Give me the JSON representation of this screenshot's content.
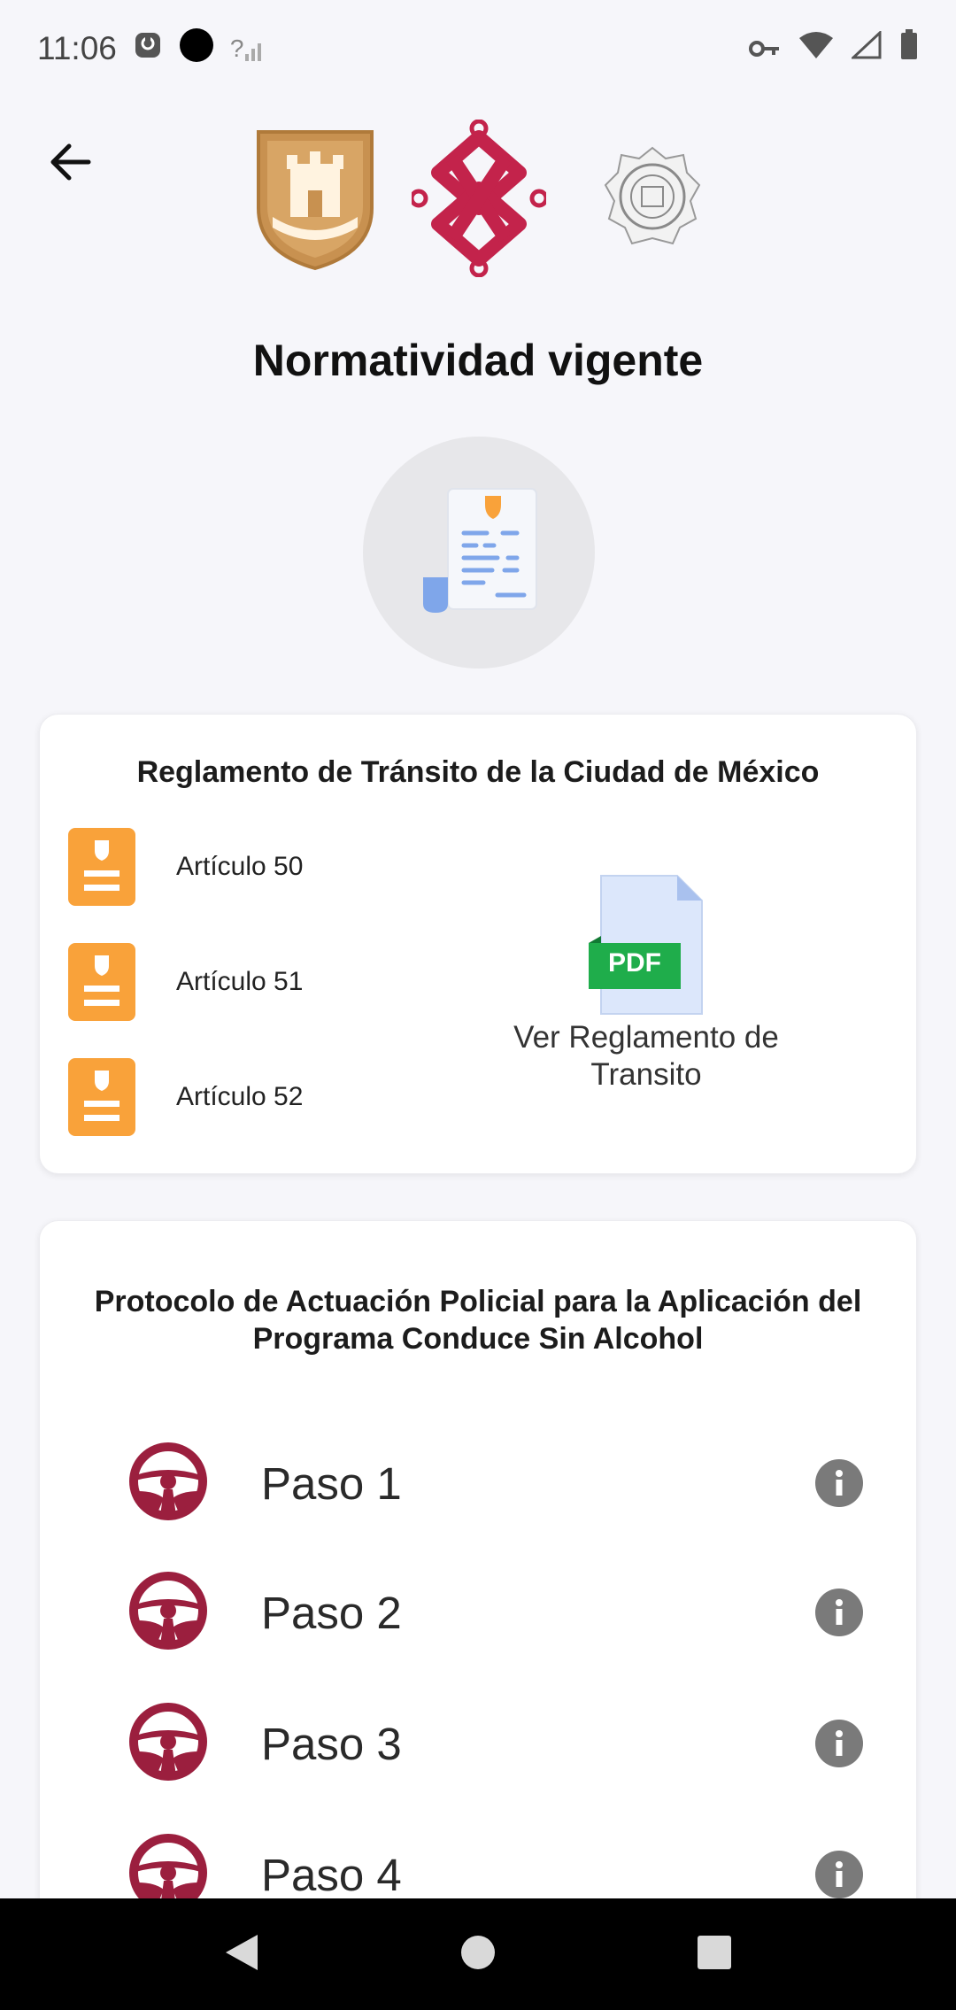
{
  "status_bar": {
    "time": "11:06",
    "signal_label": "?"
  },
  "header": {
    "title": "Normatividad vigente"
  },
  "regulation_card": {
    "title": "Reglamento de Tránsito de la Ciudad de México",
    "articles": [
      {
        "label": "Artículo 50"
      },
      {
        "label": "Artículo 51"
      },
      {
        "label": "Artículo 52"
      }
    ],
    "pdf_badge": "PDF",
    "pdf_label": "Ver Reglamento de Transito"
  },
  "protocol_card": {
    "title": "Protocolo de Actuación Policial para la Aplicación del Programa Conduce Sin Alcohol",
    "steps": [
      {
        "label": "Paso 1"
      },
      {
        "label": "Paso 2"
      },
      {
        "label": "Paso 3"
      },
      {
        "label": "Paso 4"
      }
    ]
  },
  "colors": {
    "accent_orange": "#f9a23a",
    "wheel_maroon": "#9b1f3e",
    "logo_red": "#c3234b",
    "logo_gold": "#c89150",
    "pdf_green": "#1fad4b",
    "info_gray": "#7a7a7a"
  },
  "icons": [
    "back-arrow-icon",
    "document-icon",
    "pdf-icon",
    "steering-wheel-icon",
    "info-icon"
  ]
}
